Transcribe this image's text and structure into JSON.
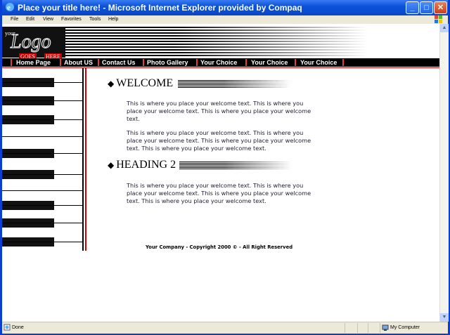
{
  "window": {
    "title": "Place your title here! - Microsoft Internet Explorer provided by Compaq",
    "minimize": "_",
    "maximize": "□",
    "close": "✕"
  },
  "menu": [
    "File",
    "Edit",
    "View",
    "Favorites",
    "Tools",
    "Help"
  ],
  "logo": {
    "your": "your",
    "logo": "Logo",
    "goes": "GOES",
    "here": "HERE"
  },
  "nav": [
    "Home Page",
    "About US",
    "Contact Us",
    "Photo Gallery",
    "Your Choice",
    "Your Choice",
    "Your Choice"
  ],
  "sections": [
    {
      "heading": "WELCOME",
      "paragraphs": [
        "This is where you place your welcome text. This is where you place your welcome text. This is where you place your welcome text.",
        "This is where you place your welcome text. This is where you place your welcome text. This is where you place your welcome text. This is where you place your welcome text."
      ]
    },
    {
      "heading": "HEADING 2",
      "paragraphs": [
        "This is where you place your welcome text. This is where you place your welcome text. This is where you place your welcome text. This is where you place your welcome text."
      ]
    }
  ],
  "footer": "Your Company - Copyright 2000 © - All Right Reserved",
  "status": {
    "left": "Done",
    "zone": "My Computer"
  },
  "colors": {
    "titlebar": "#0b52d9",
    "nav_bg": "#000000",
    "accent_red": "#cc0000"
  }
}
